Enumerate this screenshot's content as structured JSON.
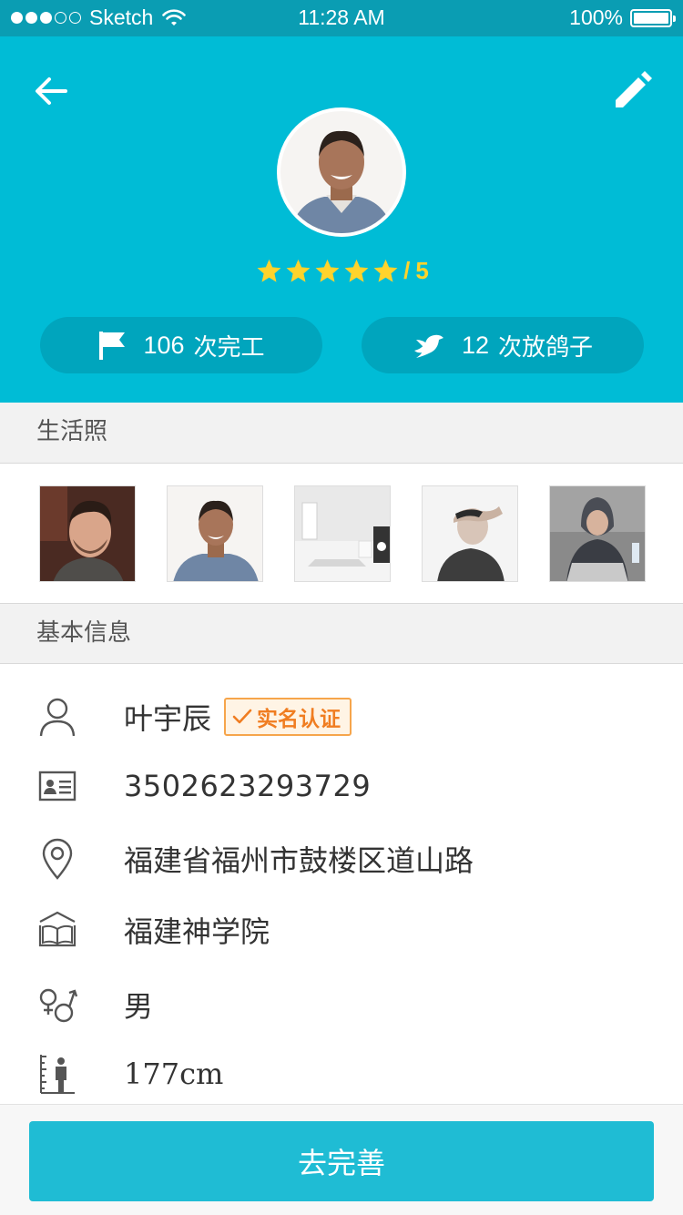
{
  "status_bar": {
    "carrier": "Sketch",
    "time": "11:28 AM",
    "battery": "100%",
    "battery_level": 1.0
  },
  "header": {
    "back_icon": "arrow-left-icon",
    "edit_icon": "pencil-icon",
    "background_color": "#00bcd6",
    "rating": {
      "stars": 5,
      "max": 5,
      "separator": "/",
      "max_label": "5",
      "star_color": "#ffd32c"
    },
    "stats": [
      {
        "icon": "flag-icon",
        "count": "106",
        "label": "次完工"
      },
      {
        "icon": "bird-icon",
        "count": "12",
        "label": "次放鸽子"
      }
    ]
  },
  "sections": {
    "photos_title": "生活照",
    "info_title": "基本信息"
  },
  "profile": {
    "name": "叶宇辰",
    "verified_label": "实名认证",
    "id_number": "3502623293729",
    "address": "福建省福州市鼓楼区道山路",
    "school": "福建神学院",
    "gender": "男",
    "height": "177cm"
  },
  "footer": {
    "button_label": "去完善",
    "button_color": "#1fbcd4"
  }
}
